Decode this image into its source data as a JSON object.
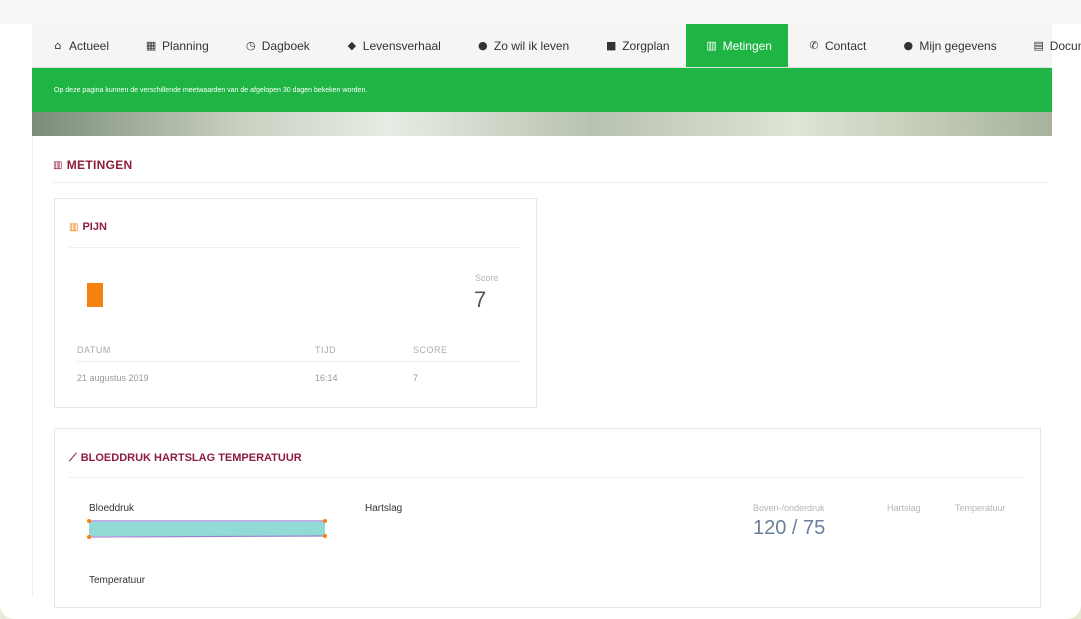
{
  "nav": {
    "items": [
      {
        "label": "Actueel",
        "icon": "bank-icon",
        "glyph": "⌂",
        "active": false
      },
      {
        "label": "Planning",
        "icon": "calendar-icon",
        "glyph": "▦",
        "active": false
      },
      {
        "label": "Dagboek",
        "icon": "clock-icon",
        "glyph": "◷",
        "active": false
      },
      {
        "label": "Levensverhaal",
        "icon": "book-icon",
        "glyph": "◆",
        "active": false
      },
      {
        "label": "Zo wil ik leven",
        "icon": "user-icon",
        "glyph": "●",
        "active": false
      },
      {
        "label": "Zorgplan",
        "icon": "file-icon",
        "glyph": "■",
        "active": false
      },
      {
        "label": "Metingen",
        "icon": "chart-icon",
        "glyph": "▥",
        "active": true
      },
      {
        "label": "Contact",
        "icon": "phone-icon",
        "glyph": "✆",
        "active": false
      },
      {
        "label": "Mijn gegevens",
        "icon": "user-icon",
        "glyph": "●",
        "active": false
      },
      {
        "label": "Documenten",
        "icon": "document-icon",
        "glyph": "▤",
        "active": false
      }
    ]
  },
  "banner": {
    "text": "Op deze pagina kunnen de verschillende meetwaarden van de afgelopen 30 dagen bekeken worden."
  },
  "section": {
    "title": "METINGEN"
  },
  "pijn": {
    "title": "PIJN",
    "score_label": "Score",
    "score_value": "7",
    "table": {
      "headers": [
        "DATUM",
        "TIJD",
        "SCORE"
      ],
      "rows": [
        [
          "21 augustus 2019",
          "16:14",
          "7"
        ]
      ]
    }
  },
  "bht": {
    "title": "BLOEDDRUK HARTSLAG TEMPERATUUR",
    "bloeddruk_label": "Bloeddruk",
    "hartslag_label": "Hartslag",
    "temperatuur_label": "Temperatuur",
    "stat_labels": [
      "Boven-/onderdruk",
      "Hartslag",
      "Temperatuur"
    ],
    "stat_value": "120 / 75"
  },
  "colors": {
    "accent_green": "#1fb545",
    "title_maroon": "#8c1d3d",
    "orange": "#f5820f",
    "teal": "#7fd3cf"
  }
}
